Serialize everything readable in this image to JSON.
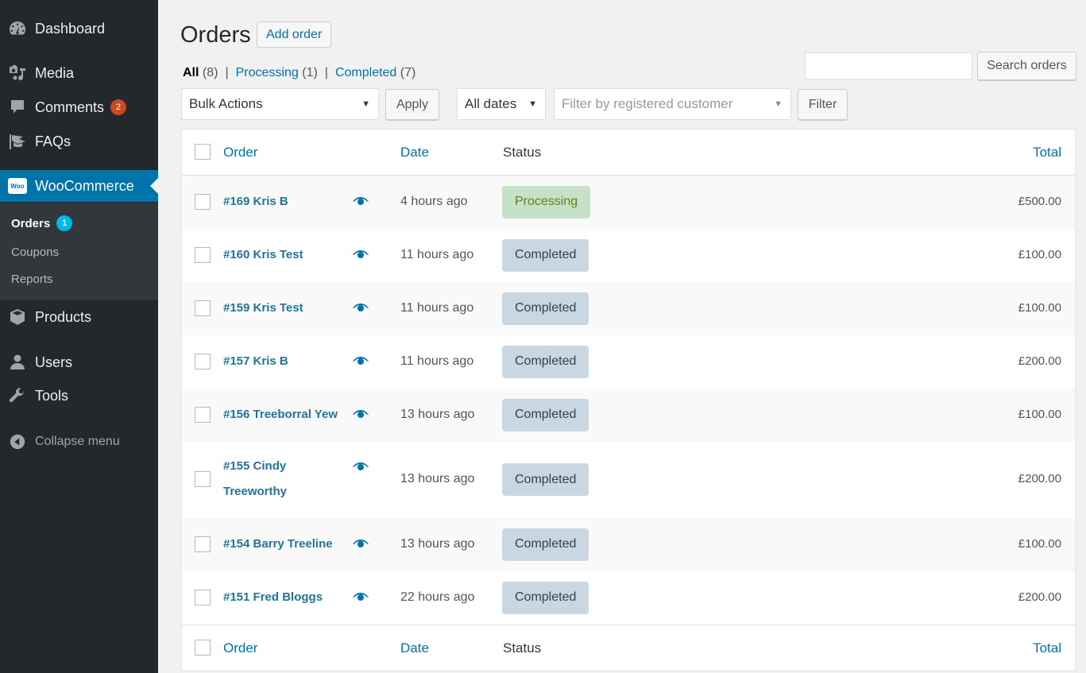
{
  "sidebar": {
    "items": [
      {
        "label": "Dashboard",
        "icon": "dashboard-icon"
      },
      {
        "label": "Media",
        "icon": "media-icon"
      },
      {
        "label": "Comments",
        "icon": "comments-icon",
        "badge": "2"
      },
      {
        "label": "FAQs",
        "icon": "faqs-icon"
      },
      {
        "label": "WooCommerce",
        "icon": "woocommerce-icon",
        "active": true,
        "logo_text": "Woo"
      },
      {
        "label": "Products",
        "icon": "products-icon"
      },
      {
        "label": "Users",
        "icon": "users-icon"
      },
      {
        "label": "Tools",
        "icon": "tools-icon"
      }
    ],
    "submenu": [
      {
        "label": "Orders",
        "current": true,
        "badge": "1"
      },
      {
        "label": "Coupons"
      },
      {
        "label": "Reports"
      }
    ],
    "collapse_label": "Collapse menu"
  },
  "header": {
    "title": "Orders",
    "add_button": "Add order"
  },
  "views": {
    "all": {
      "label": "All",
      "count": "(8)"
    },
    "processing": {
      "label": "Processing",
      "count": "(1)"
    },
    "completed": {
      "label": "Completed",
      "count": "(7)"
    },
    "separator": "|"
  },
  "search": {
    "value": "",
    "button": "Search orders"
  },
  "filters": {
    "bulk_actions": "Bulk Actions",
    "apply": "Apply",
    "dates": "All dates",
    "customer_placeholder": "Filter by registered customer",
    "filter": "Filter",
    "arrow": "▼"
  },
  "table": {
    "columns": {
      "order": "Order",
      "date": "Date",
      "status": "Status",
      "total": "Total"
    },
    "rows": [
      {
        "order": "#169 Kris B",
        "date": "4 hours ago",
        "status": "Processing",
        "total": "£500.00"
      },
      {
        "order": "#160 Kris Test",
        "date": "11 hours ago",
        "status": "Completed",
        "total": "£100.00"
      },
      {
        "order": "#159 Kris Test",
        "date": "11 hours ago",
        "status": "Completed",
        "total": "£100.00"
      },
      {
        "order": "#157 Kris B",
        "date": "11 hours ago",
        "status": "Completed",
        "total": "£200.00"
      },
      {
        "order": "#156 Treeborral Yew",
        "date": "13 hours ago",
        "status": "Completed",
        "total": "£100.00"
      },
      {
        "order": "#155 Cindy Treeworthy",
        "order_line1": "#155 Cindy",
        "order_line2": "Treeworthy",
        "date": "13 hours ago",
        "status": "Completed",
        "total": "£200.00"
      },
      {
        "order": "#154 Barry Treeline",
        "date": "13 hours ago",
        "status": "Completed",
        "total": "£100.00"
      },
      {
        "order": "#151 Fred Bloggs",
        "date": "22 hours ago",
        "status": "Completed",
        "total": "£200.00"
      }
    ]
  },
  "colors": {
    "accent": "#0073aa",
    "sidebar_bg": "#23282d",
    "processing_bg": "#c6e1c6",
    "processing_text": "#5b841b",
    "completed_bg": "#c8d7e1",
    "completed_text": "#2e4453",
    "comments_badge": "#ca4a1f",
    "orders_badge": "#00b9eb"
  }
}
